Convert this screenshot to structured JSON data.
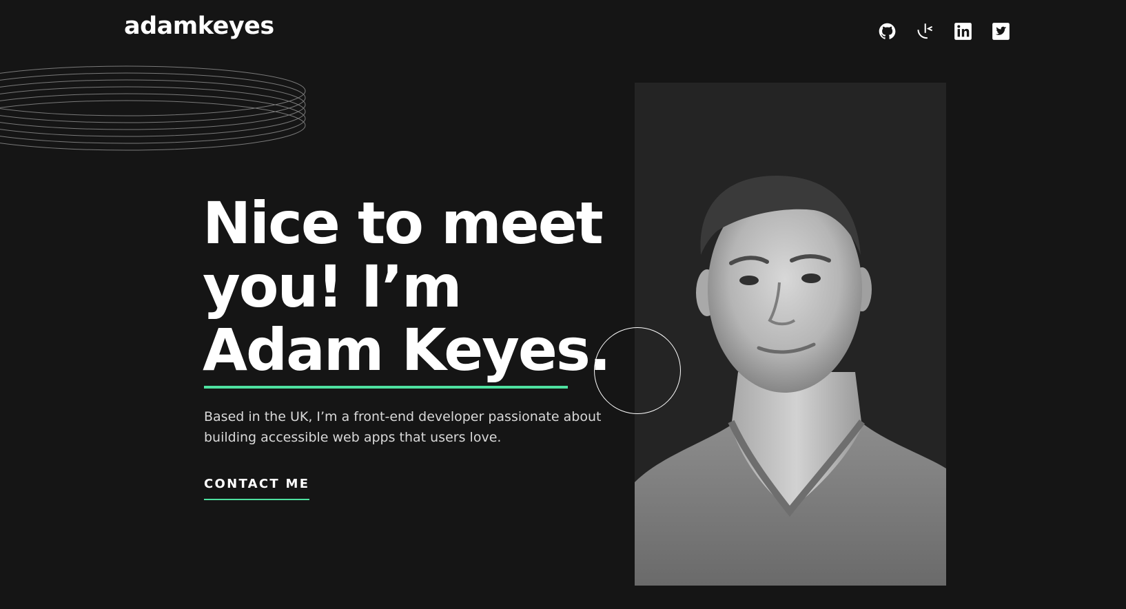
{
  "header": {
    "logo": "adamkeyes",
    "socials": [
      {
        "name": "github",
        "icon": "github-icon"
      },
      {
        "name": "frontend-mentor",
        "icon": "frontend-mentor-icon"
      },
      {
        "name": "linkedin",
        "icon": "linkedin-icon"
      },
      {
        "name": "twitter",
        "icon": "twitter-icon"
      }
    ]
  },
  "hero": {
    "headline_lines": [
      "Nice to meet",
      "you! I’m",
      "Adam Keyes."
    ],
    "intro_line1": "Based in the UK, I’m a front-end developer passionate about",
    "intro_line2": "building accessible web apps that users love.",
    "cta": "CONTACT ME"
  },
  "colors": {
    "background": "#151515",
    "accent": "#4ee1a0",
    "text": "#ffffff",
    "muted": "#d9d9d9"
  }
}
